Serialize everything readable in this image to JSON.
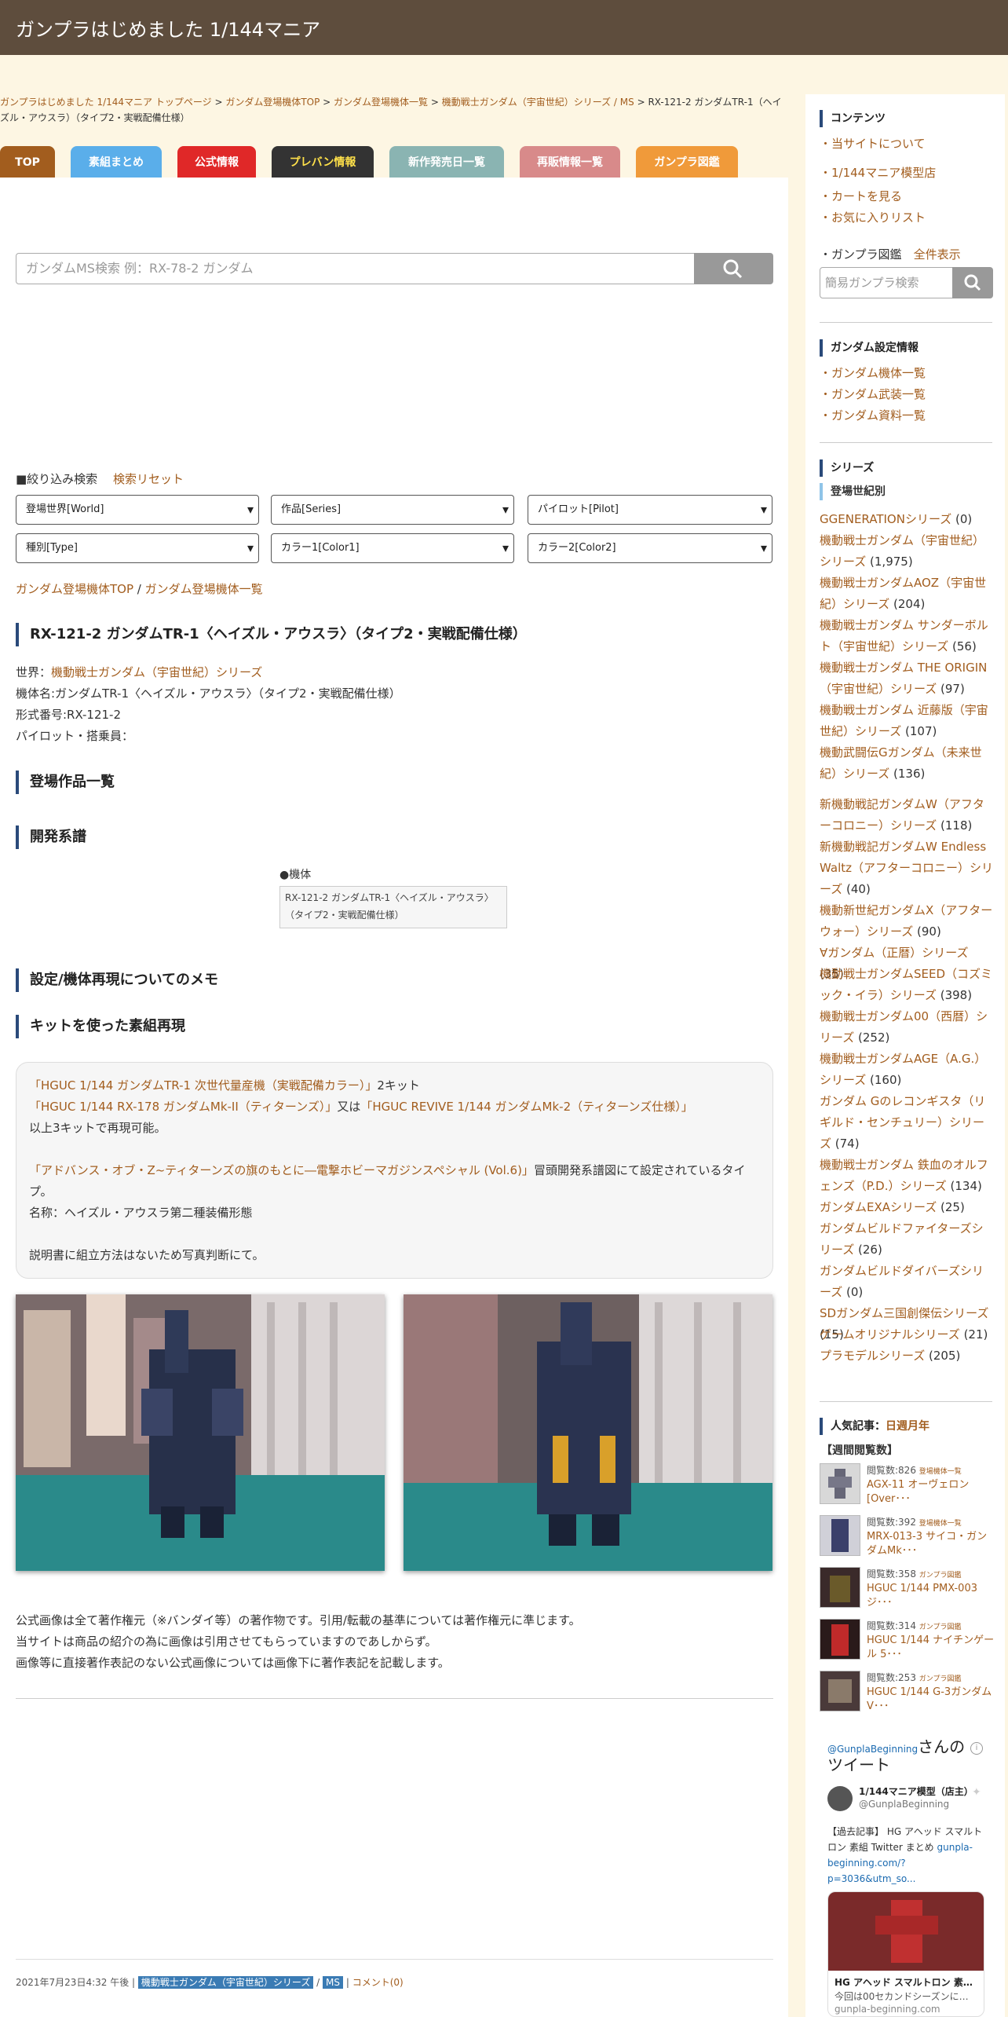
{
  "site_title": "ガンプラはじめました 1/144マニア",
  "breadcrumb": {
    "items": [
      "ガンプラはじめました 1/144マニア トップページ",
      "ガンダム登場機体TOP",
      "ガンダム登場機体一覧",
      "機動戦士ガンダム（宇宙世紀）シリーズ / MS"
    ],
    "current": "RX-121-2 ガンダムTR-1（ヘイズル・アウスラ）（タイプ2・実戦配備仕様）"
  },
  "gnav": [
    {
      "label": "TOP",
      "color": "#a25d1e"
    },
    {
      "label": "素組まとめ",
      "color": "#5aaeea"
    },
    {
      "label": "公式情報",
      "color": "#e02828"
    },
    {
      "label": "プレバン情報",
      "color": "#333333"
    },
    {
      "label": "新作発売日一覧",
      "color": "#8ab4b2"
    },
    {
      "label": "再販情報一覧",
      "color": "#d88a8a"
    },
    {
      "label": "ガンプラ図鑑",
      "color": "#f09a3a"
    }
  ],
  "search": {
    "placeholder": "ガンダムMS検索 例：RX-78-2 ガンダム",
    "refine_label": "■絞り込み検索",
    "reset_label": "検索リセット",
    "selects": [
      "登場世界[World]",
      "作品[Series]",
      "パイロット[Pilot]",
      "種別[Type]",
      "カラー1[Color1]",
      "カラー2[Color2]"
    ]
  },
  "links_top": {
    "a": "ガンダム登場機体TOP",
    "sep": " / ",
    "b": "ガンダム登場機体一覧"
  },
  "ms": {
    "title": "RX-121-2 ガンダムTR-1〈ヘイズル・アウスラ〉（タイプ2・実戦配備仕様）",
    "world_label": "世界：",
    "world": "機動戦士ガンダム（宇宙世紀）シリーズ",
    "name": "機体名:ガンダムTR-1〈ヘイズル・アウスラ〉（タイプ2・実戦配備仕様）",
    "model": "形式番号:RX-121-2",
    "pilot": "パイロット・搭乗員："
  },
  "sections": {
    "appear": "登場作品一覧",
    "dev": "開発系譜",
    "memo": "設定/機体再現についてのメモ",
    "kit": "キットを使った素組再現"
  },
  "tree": {
    "label": "●機体",
    "box1": "RX-121-2 ガンダムTR-1〈ヘイズル・アウスラ〉",
    "box2": "（タイプ2・実戦配備仕様）"
  },
  "memo": {
    "l1a": "「HGUC 1/144 ガンダムTR-1 次世代量産機（実戦配備カラー）」",
    "l1b": "2キット",
    "l2a": "「HGUC 1/144 RX-178 ガンダムMk-II（ティターンズ）」",
    "l2b": "又は",
    "l2c": "「HGUC REVIVE 1/144 ガンダムMk-2（ティターンズ仕様）」",
    "l3": "以上3キットで再現可能。",
    "l4a": "「アドバンス・オブ・Z~ティターンズの旗のもとに―電撃ホビーマガジンスペシャル (Vol.6)」",
    "l4b": "冒頭開発系譜図にて設定されているタイプ。",
    "l5": "名称：ヘイズル・アウスラ第二種装備形態",
    "l6": "説明書に組立方法はないため写真判断にて。"
  },
  "copyright": [
    "公式画像は全て著作権元（※バンダイ等）の著作物です。引用/転載の基準については著作権元に準じます。",
    "当サイトは商品の紹介の為に画像は引用させてもらっていますのであしからず。",
    "画像等に直接著作表記のない公式画像については画像下に著作表記を記載します。"
  ],
  "footer_meta": {
    "date": "2021年7月23日4:32 午後",
    "sep": "|",
    "cat1": "機動戦士ガンダム（宇宙世紀）シリーズ",
    "slash": "/",
    "cat2": "MS",
    "sep2": "|",
    "comment": "コメント(0)"
  },
  "sidebar": {
    "contents_h": "コンテンツ",
    "links1": [
      "・当サイトについて",
      "・1/144マニア模型店",
      "・カートを見る",
      "・お気に入りリスト"
    ],
    "zukan": "・ガンプラ図鑑",
    "zukan_all": "全件表示",
    "zukan_search_placeholder": "簡易ガンプラ検索",
    "setting_h": "ガンダム設定情報",
    "links2": [
      "・ガンダム機体一覧",
      "・ガンダム武装一覧",
      "・ガンダム資料一覧"
    ],
    "series_h": "シリーズ",
    "series_sub": "登場世紀別",
    "series": [
      {
        "a": "GGENERATIONシリーズ",
        "c": " (0)"
      },
      {
        "a": "機動戦士ガンダム（宇宙世紀）シリーズ",
        "c": " (1,975)"
      },
      {
        "a": "機動戦士ガンダムAOZ（宇宙世紀）シリーズ",
        "c": " (204)"
      },
      {
        "a": "機動戦士ガンダム サンダーボルト（宇宙世紀）シリーズ",
        "c": " (56)"
      },
      {
        "a": "機動戦士ガンダム THE ORIGIN（宇宙世紀）シリーズ",
        "c": " (97)"
      },
      {
        "a": "機動戦士ガンダム 近藤版（宇宙世紀）シリーズ",
        "c": " (107)"
      },
      {
        "a": "機動武闘伝Gガンダム（未来世紀）シリーズ",
        "c": " (136)"
      },
      {
        "a": "新機動戦記ガンダムW（アフターコロニー）シリーズ",
        "c": " (118)"
      },
      {
        "a": "新機動戦記ガンダムW Endless Waltz（アフターコロニー）シリーズ",
        "c": " (40)"
      },
      {
        "a": "機動新世紀ガンダムX（アフターウォー）シリーズ",
        "c": " (90)"
      },
      {
        "a": "∀ガンダム（正暦）シリーズ",
        "c": " (35)"
      },
      {
        "a": "機動戦士ガンダムSEED（コズミック・イラ）シリーズ",
        "c": " (398)"
      },
      {
        "a": "機動戦士ガンダム00（西暦）シリーズ",
        "c": " (252)"
      },
      {
        "a": "機動戦士ガンダムAGE（A.G.）シリーズ",
        "c": " (160)"
      },
      {
        "a": "ガンダム Gのレコンギスタ（リギルド・センチュリー）シリーズ",
        "c": " (74)"
      },
      {
        "a": "機動戦士ガンダム 鉄血のオルフェンズ（P.D.）シリーズ",
        "c": " (134)"
      },
      {
        "a": "ガンダムEXAシリーズ",
        "c": " (25)"
      },
      {
        "a": "ガンダムビルドファイターズシリーズ",
        "c": " (26)"
      },
      {
        "a": "ガンダムビルドダイバーズシリーズ",
        "c": " (0)"
      },
      {
        "a": "SDガンダム三国創傑伝シリーズ",
        "c": " (15)"
      },
      {
        "a": "ゲームオリジナルシリーズ",
        "c": " (21)"
      },
      {
        "a": "プラモデルシリーズ",
        "c": " (205)"
      }
    ],
    "popular_h": "人気記事：",
    "popular_tabs": "日週月年",
    "weekly": "【週間閲覧数】",
    "popular": [
      {
        "meta": "閲覧数:826",
        "cat": "登場機体一覧",
        "title": "AGX-11 オーヴェロン [Over･･･"
      },
      {
        "meta": "閲覧数:392",
        "cat": "登場機体一覧",
        "title": "MRX-013-3 サイコ・ガンダムMk･･･"
      },
      {
        "meta": "閲覧数:358",
        "cat": "ガンプラ図鑑",
        "title": "HGUC 1/144 PMX-003 ジ･･･"
      },
      {
        "meta": "閲覧数:314",
        "cat": "ガンプラ図鑑",
        "title": "HGUC 1/144 ナイチンゲール 5･･･"
      },
      {
        "meta": "閲覧数:253",
        "cat": "ガンプラ図鑑",
        "title": "HGUC 1/144 G-3ガンダム V･･･"
      }
    ],
    "tw_handle": "@GunplaBeginning",
    "tw_san": "さんのツイート",
    "tw_name": "1/144マニア模型（店主）",
    "tw_id": "@GunplaBeginning",
    "tw_text": "【過去記事】 HG アヘッド スマルトロン 素組 Twitter まとめ",
    "tw_link": "gunpla-beginning.com/?p=3036&utm_so...",
    "card_title": "HG アヘッド スマルトロン 素…",
    "card_sub": "今回は00セカンドシーズンに…",
    "card_url": "gunpla-beginning.com"
  }
}
